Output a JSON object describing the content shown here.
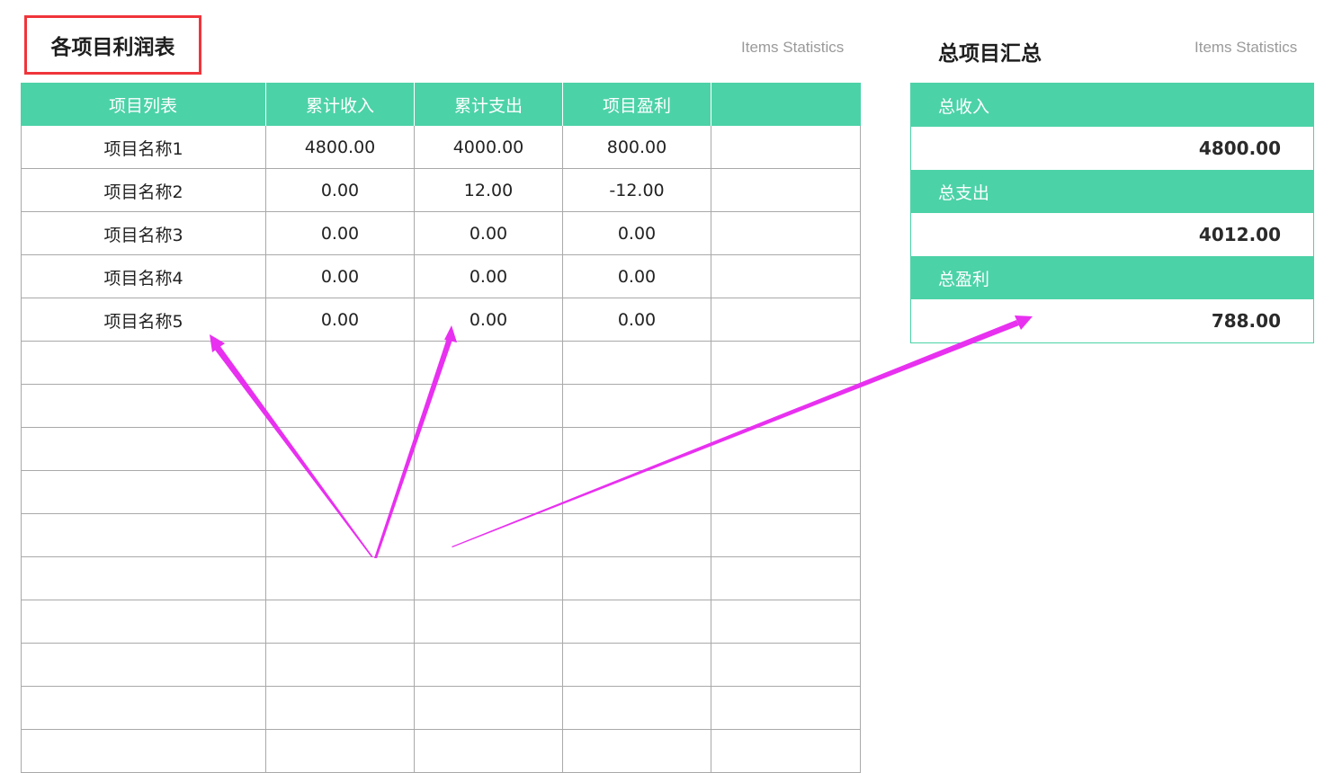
{
  "left_title": "各项目利润表",
  "left_subtitle": "Items Statistics",
  "right_title": "总项目汇总",
  "right_subtitle": "Items Statistics",
  "table": {
    "headers": [
      "项目列表",
      "累计收入",
      "累计支出",
      "项目盈利",
      ""
    ],
    "rows": [
      [
        "项目名称1",
        "4800.00",
        "4000.00",
        "800.00",
        ""
      ],
      [
        "项目名称2",
        "0.00",
        "12.00",
        "-12.00",
        ""
      ],
      [
        "项目名称3",
        "0.00",
        "0.00",
        "0.00",
        ""
      ],
      [
        "项目名称4",
        "0.00",
        "0.00",
        "0.00",
        ""
      ],
      [
        "项目名称5",
        "0.00",
        "0.00",
        "0.00",
        ""
      ],
      [
        "",
        "",
        "",
        "",
        ""
      ],
      [
        "",
        "",
        "",
        "",
        ""
      ],
      [
        "",
        "",
        "",
        "",
        ""
      ],
      [
        "",
        "",
        "",
        "",
        ""
      ],
      [
        "",
        "",
        "",
        "",
        ""
      ],
      [
        "",
        "",
        "",
        "",
        ""
      ],
      [
        "",
        "",
        "",
        "",
        ""
      ],
      [
        "",
        "",
        "",
        "",
        ""
      ],
      [
        "",
        "",
        "",
        "",
        ""
      ],
      [
        "",
        "",
        "",
        "",
        ""
      ]
    ]
  },
  "summary": {
    "total_income_label": "总收入",
    "total_income_value": "4800.00",
    "total_expense_label": "总支出",
    "total_expense_value": "4012.00",
    "total_profit_label": "总盈利",
    "total_profit_value": "788.00"
  },
  "colors": {
    "header_green": "#4cd2a7",
    "highlight_red": "#f0353b",
    "arrow_magenta": "#e830f0"
  }
}
